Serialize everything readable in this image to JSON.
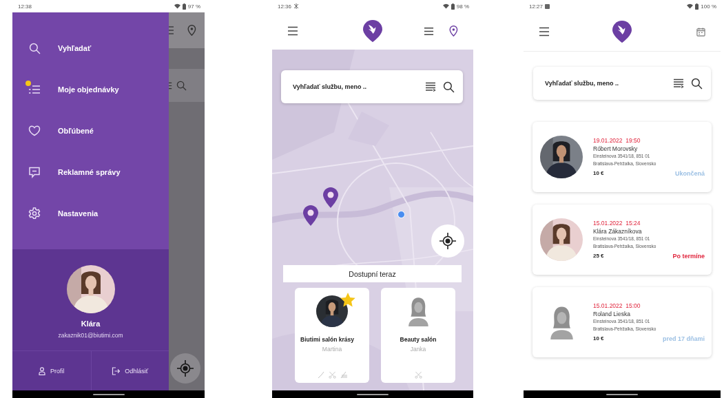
{
  "drawer_screen": {
    "status_bar": {
      "time": "12:38",
      "battery": "97 %"
    },
    "menu": [
      {
        "kind": "search",
        "label": "Vyhľadať",
        "notification": false
      },
      {
        "kind": "orders",
        "label": "Moje objednávky",
        "notification": true
      },
      {
        "kind": "favorites",
        "label": "Obľúbené",
        "notification": false
      },
      {
        "kind": "messages",
        "label": "Reklamné správy",
        "notification": false
      },
      {
        "kind": "settings",
        "label": "Nastavenia",
        "notification": false
      }
    ],
    "profile": {
      "name": "Klára",
      "email": "zakaznik01@biutimi.com"
    },
    "actions": [
      {
        "kind": "profile",
        "label": "Profil"
      },
      {
        "kind": "logout",
        "label": "Odhlásiť"
      }
    ]
  },
  "map_screen": {
    "status_bar": {
      "time": "12:36",
      "battery": "98 %"
    },
    "search": {
      "placeholder": "Vyhľadať službu, meno .."
    },
    "available_title": "Dostupní teraz",
    "salons": [
      {
        "name": "Biutimi salón krásy",
        "person": "Martina",
        "featured": true
      },
      {
        "kind": "silhouette",
        "name": "Beauty salón",
        "person": "Janka",
        "featured": false
      }
    ]
  },
  "orders_screen": {
    "status_bar": {
      "time": "12:27",
      "battery": "100 %"
    },
    "search": {
      "placeholder": "Vyhľadať službu, meno .."
    },
    "orders": [
      {
        "date": "19.01.2022  19:50",
        "name": "Róbert Morovsky",
        "address_line1": "Einsteinova 3541/18, 851 01",
        "address_line2": "Bratislava-Petržalka, Slovensko",
        "price": "10 €",
        "status": "Ukončená",
        "color": "#9cc0e4"
      },
      {
        "date": "15.01.2022  15:24",
        "name": "Klára Zákazníkova",
        "address_line1": "Einsteinova 3541/18, 851 01",
        "address_line2": "Bratislava-Petržalka, Slovensko",
        "price": "25 €",
        "status": "Po termíne",
        "color": "#e0243c"
      },
      {
        "kind": "silhouette",
        "date": "15.01.2022  15:00",
        "name": "Roland Lieska",
        "address_line1": "Einsteinova 3541/18, 851 01",
        "address_line2": "Bratislava-Petržalka, Slovensko",
        "price": "10 €",
        "status": "pred 17 dňami",
        "color": "#9cc0e4"
      }
    ]
  }
}
